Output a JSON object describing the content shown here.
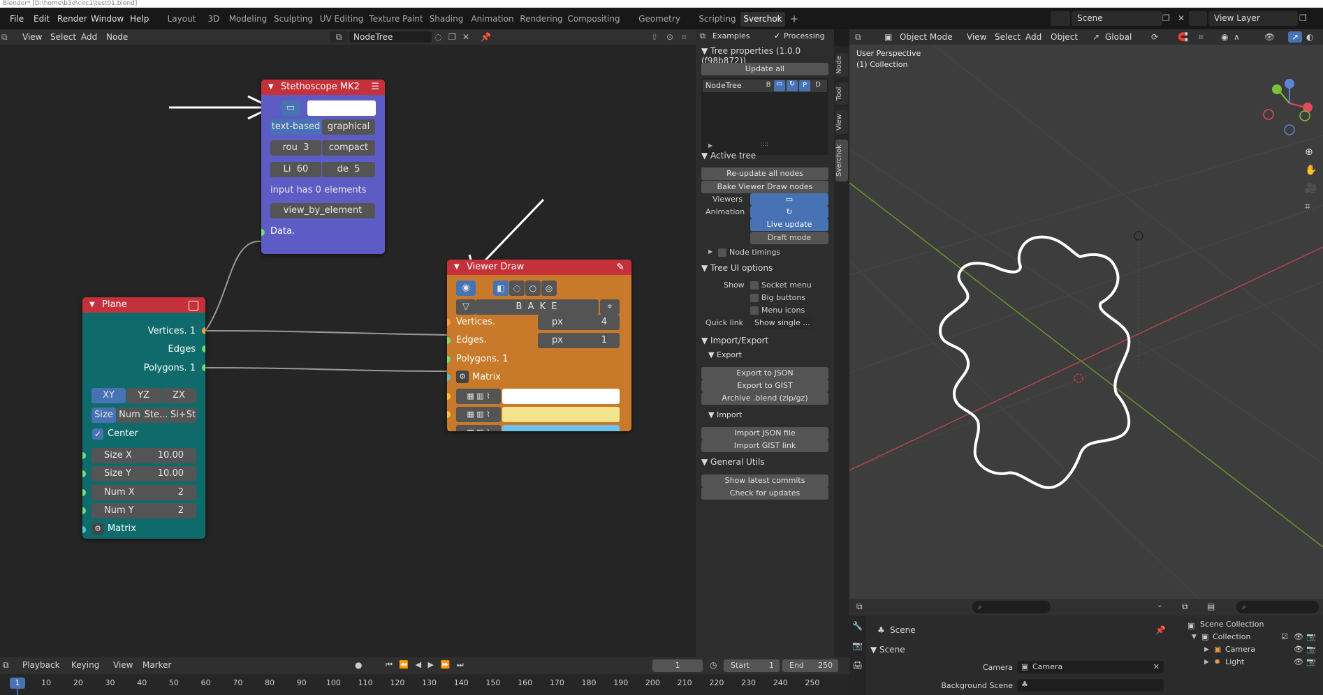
{
  "window": {
    "title": "Blender* [D:\\home\\b3d\\circ1\\test01.blend]"
  },
  "menus": [
    "File",
    "Edit",
    "Render",
    "Window",
    "Help"
  ],
  "workspaces": [
    "Layout",
    "3D",
    "Modeling",
    "Sculpting",
    "UV Editing",
    "Texture Paint",
    "Shading",
    "Animation",
    "Rendering",
    "Compositing",
    "Geometry Nodes",
    "Scripting",
    "Sverchok"
  ],
  "active_workspace": "Sverchok",
  "scene": {
    "label": "Scene"
  },
  "view_layer": {
    "label": "View Layer"
  },
  "node_editor": {
    "header": {
      "menus": [
        "View",
        "Select",
        "Add",
        "Node"
      ],
      "tree_name": "NodeTree"
    },
    "stethoscope": {
      "title": "Stethoscope MK2",
      "mode_text": "text-based",
      "mode_graph": "graphical",
      "rou": "rou",
      "rou_val": "3",
      "compact": "compact",
      "li": "Li",
      "li_val": "60",
      "de": "de",
      "de_val": "5",
      "info": "input has 0 elements",
      "button": "view_by_element",
      "socket": "Data."
    },
    "plane": {
      "title": "Plane",
      "outputs": [
        "Vertices. 1",
        "Edges",
        "Polygons. 1"
      ],
      "planes": [
        "XY",
        "YZ",
        "ZX"
      ],
      "modes": [
        "Size",
        "Num",
        "Ste...",
        "Si+St"
      ],
      "center": "Center",
      "size_x_label": "Size X",
      "size_x": "10.00",
      "size_y_label": "Size Y",
      "size_y": "10.00",
      "num_x_label": "Num X",
      "num_x": "2",
      "num_y_label": "Num Y",
      "num_y": "2",
      "matrix": "Matrix"
    },
    "viewer": {
      "title": "Viewer Draw",
      "bake": "B A K E",
      "vertices": "Vertices.",
      "vert_unit": "px",
      "vert_val": "4",
      "edges": "Edges.",
      "edge_unit": "px",
      "edge_val": "1",
      "polygons": "Polygons. 1",
      "matrix": "Matrix"
    }
  },
  "sidebar": {
    "examples": "Examples",
    "processing": "Processing",
    "tree_props": "Tree properties (1.0.0 (f98b872))",
    "update_all": "Update all",
    "tree_item": "NodeTree",
    "tree_flags": [
      "B",
      "P",
      "D"
    ],
    "active_tree": "Active tree",
    "reupdate": "Re-update all nodes",
    "bake_viewer": "Bake Viewer Draw nodes",
    "viewers": "Viewers",
    "animation": "Animation",
    "live_update": "Live update",
    "draft_mode": "Draft mode",
    "node_timings": "Node timings",
    "tree_ui": "Tree UI options",
    "show": "Show",
    "socket_menu": "Socket menu",
    "big_buttons": "Big buttons",
    "menu_icons": "Menu icons",
    "quick_link": "Quick link",
    "quick_link_val": "Show single ...",
    "import_export": "Import/Export",
    "export": "Export",
    "export_json": "Export to JSON",
    "export_gist": "Export to GIST",
    "archive": "Archive .blend (zip/gz)",
    "import": "Import",
    "import_json": "Import JSON file",
    "import_gist": "Import GIST link",
    "general_utils": "General Utils",
    "show_commits": "Show latest commits",
    "check_updates": "Check for updates",
    "vtabs": [
      "Node",
      "Tool",
      "View",
      "Sverchok"
    ]
  },
  "viewport": {
    "mode": "Object Mode",
    "menus": [
      "View",
      "Select",
      "Add",
      "Object"
    ],
    "orientation": "Global",
    "perspective": "User Perspective",
    "collection": "(1) Collection"
  },
  "properties": {
    "scene": "Scene",
    "scene_panel": "Scene",
    "camera_label": "Camera",
    "camera_val": "Camera",
    "bg_label": "Background Scene"
  },
  "outliner": {
    "root": "Scene Collection",
    "collection": "Collection",
    "items": [
      "Camera",
      "Light"
    ]
  },
  "timeline": {
    "menus": [
      "Playback",
      "Keying",
      "View",
      "Marker"
    ],
    "current_frame": "1",
    "start_label": "Start",
    "start": "1",
    "end_label": "End",
    "end": "250",
    "ticks": [
      "1",
      "10",
      "20",
      "30",
      "40",
      "50",
      "60",
      "70",
      "80",
      "90",
      "100",
      "110",
      "120",
      "130",
      "140",
      "150",
      "160",
      "170",
      "180",
      "190",
      "200",
      "210",
      "220",
      "230",
      "240",
      "250"
    ]
  },
  "colors": {
    "stethoscope": "#5c5cc4",
    "plane": "#0f6b6b",
    "viewer": "#c87a2a",
    "node_header": "#c4313a",
    "accent": "#4772b3"
  }
}
